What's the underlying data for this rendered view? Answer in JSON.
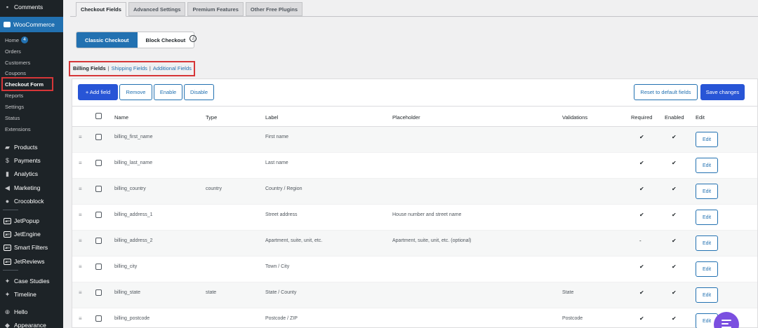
{
  "sidebar": {
    "comments": "Comments",
    "woocommerce": "WooCommerce",
    "home": "Home",
    "home_badge": "4",
    "orders": "Orders",
    "customers": "Customers",
    "coupons": "Coupons",
    "checkout_form": "Checkout Form",
    "reports": "Reports",
    "settings": "Settings",
    "status": "Status",
    "extensions": "Extensions",
    "products": "Products",
    "payments": "Payments",
    "analytics": "Analytics",
    "marketing": "Marketing",
    "crocoblock": "Crocoblock",
    "jetpopup": "JetPopup",
    "jetengine": "JetEngine",
    "smart_filters": "Smart Filters",
    "jetreviews": "JetReviews",
    "case_studies": "Case Studies",
    "timeline": "Timeline",
    "hello": "Hello",
    "appearance": "Appearance"
  },
  "tabs": [
    "Checkout Fields",
    "Advanced Settings",
    "Premium Features",
    "Other Free Plugins"
  ],
  "checkout_toggle": {
    "classic": "Classic Checkout",
    "block": "Block Checkout",
    "info": "i"
  },
  "subnav": {
    "billing": "Billing Fields",
    "shipping": "Shipping Fields",
    "additional": "Additional Fields",
    "sep": "|"
  },
  "toolbar": {
    "add": "+ Add field",
    "remove": "Remove",
    "enable": "Enable",
    "disable": "Disable",
    "reset": "Reset to default fields",
    "save": "Save changes"
  },
  "columns": [
    "Name",
    "Type",
    "Label",
    "Placeholder",
    "Validations",
    "Required",
    "Enabled",
    "Edit"
  ],
  "rows": [
    {
      "name": "billing_first_name",
      "type": "",
      "label": "First name",
      "placeholder": "",
      "validations": "",
      "required": "✔",
      "enabled": "✔",
      "edit": "Edit"
    },
    {
      "name": "billing_last_name",
      "type": "",
      "label": "Last name",
      "placeholder": "",
      "validations": "",
      "required": "✔",
      "enabled": "✔",
      "edit": "Edit"
    },
    {
      "name": "billing_country",
      "type": "country",
      "label": "Country / Region",
      "placeholder": "",
      "validations": "",
      "required": "✔",
      "enabled": "✔",
      "edit": "Edit"
    },
    {
      "name": "billing_address_1",
      "type": "",
      "label": "Street address",
      "placeholder": "House number and street name",
      "validations": "",
      "required": "✔",
      "enabled": "✔",
      "edit": "Edit"
    },
    {
      "name": "billing_address_2",
      "type": "",
      "label": "Apartment, suite, unit, etc.",
      "placeholder": "Apartment, suite, unit, etc. (optional)",
      "validations": "",
      "required": "-",
      "enabled": "✔",
      "edit": "Edit"
    },
    {
      "name": "billing_city",
      "type": "",
      "label": "Town / City",
      "placeholder": "",
      "validations": "",
      "required": "✔",
      "enabled": "✔",
      "edit": "Edit"
    },
    {
      "name": "billing_state",
      "type": "state",
      "label": "State / County",
      "placeholder": "",
      "validations": "State",
      "required": "✔",
      "enabled": "✔",
      "edit": "Edit"
    },
    {
      "name": "billing_postcode",
      "type": "",
      "label": "Postcode / ZIP",
      "placeholder": "",
      "validations": "Postcode",
      "required": "✔",
      "enabled": "✔",
      "edit": "Edit"
    }
  ]
}
